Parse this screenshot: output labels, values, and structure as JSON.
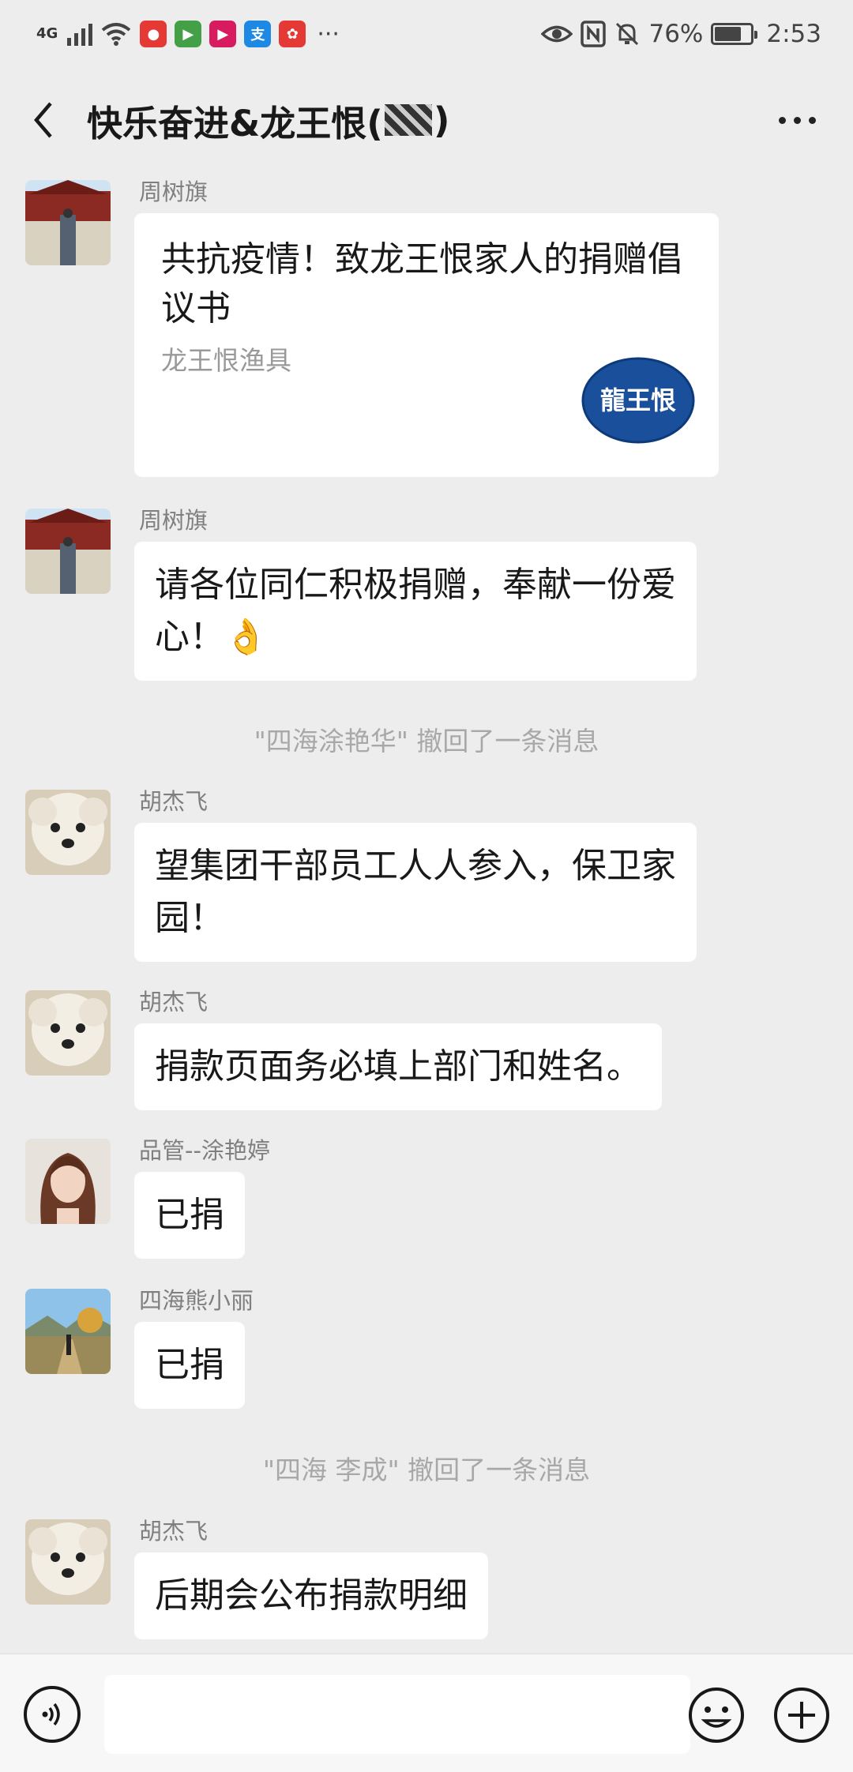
{
  "status_bar": {
    "network": "4G",
    "apps": [
      {
        "name": "mic-app-icon",
        "color": "#e53935",
        "glyph": "●"
      },
      {
        "name": "play-app-icon",
        "color": "#43a047",
        "glyph": "▶"
      },
      {
        "name": "video-app-icon",
        "color": "#d81b60",
        "glyph": "▶"
      },
      {
        "name": "alipay-app-icon",
        "color": "#1e88e5",
        "glyph": "支"
      },
      {
        "name": "shopping-app-icon",
        "color": "#e53935",
        "glyph": "✿"
      }
    ],
    "more": "···",
    "battery_text": "76%",
    "battery_level": 0.76,
    "time": "2:53"
  },
  "header": {
    "title_prefix": "快乐奋进&龙王恨(",
    "title_suffix": ")"
  },
  "messages": [
    {
      "type": "card",
      "sender": "周树旗",
      "avatar": "palace",
      "card_title": "共抗疫情！致龙王恨家人的捐赠倡议书",
      "card_source": "龙王恨渔具",
      "logo_text": "龍王恨"
    },
    {
      "type": "text",
      "sender": "周树旗",
      "avatar": "palace",
      "lines": [
        "请各位同仁积极捐赠，奉献一份爱",
        "心！👌"
      ]
    },
    {
      "type": "system",
      "text": "\"四海涂艳华\" 撤回了一条消息"
    },
    {
      "type": "text",
      "sender": "胡杰飞",
      "avatar": "dog",
      "lines": [
        "望集团干部员工人人参入，保卫家",
        "园！"
      ]
    },
    {
      "type": "text",
      "sender": "胡杰飞",
      "avatar": "dog",
      "lines": [
        "捐款页面务必填上部门和姓名。"
      ]
    },
    {
      "type": "text",
      "sender": "品管--涂艳婷",
      "avatar": "woman",
      "lines": [
        "已捐"
      ]
    },
    {
      "type": "text",
      "sender": "四海熊小丽",
      "avatar": "landscape",
      "lines": [
        "已捐"
      ]
    },
    {
      "type": "system",
      "text": "\"四海 李成\" 撤回了一条消息"
    },
    {
      "type": "text",
      "sender": "胡杰飞",
      "avatar": "dog",
      "lines": [
        "后期会公布捐款明细"
      ]
    }
  ],
  "input": {
    "value": ""
  }
}
